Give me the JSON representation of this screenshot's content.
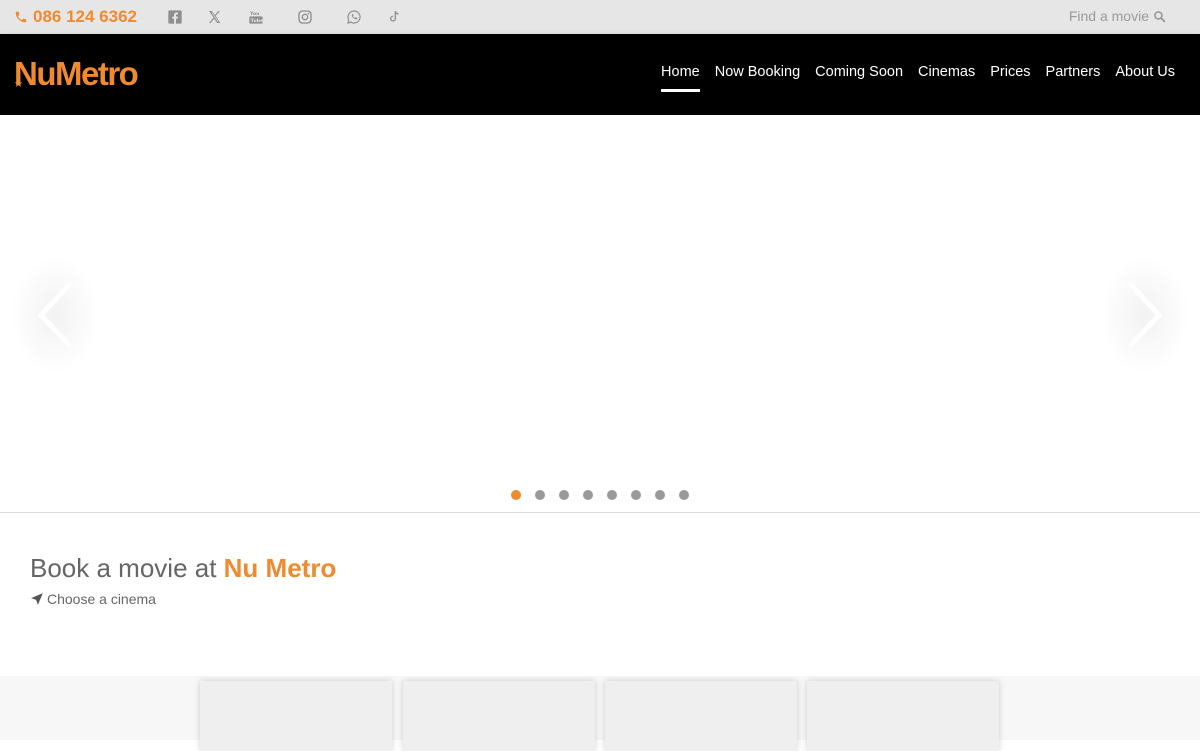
{
  "topbar": {
    "phone": "086 124 6362",
    "social_icons": [
      "facebook-icon",
      "x-icon",
      "youtube-icon",
      "instagram-icon",
      "whatsapp-icon",
      "tiktok-icon"
    ],
    "find_label": "Find a movie"
  },
  "brand": {
    "logo_text": "NuMetro",
    "accent_color": "#ef8a2e"
  },
  "nav": {
    "items": [
      {
        "label": "Home",
        "active": true
      },
      {
        "label": "Now Booking"
      },
      {
        "label": "Coming Soon"
      },
      {
        "label": "Cinemas"
      },
      {
        "label": "Prices"
      },
      {
        "label": "Partners"
      },
      {
        "label": "About Us"
      }
    ]
  },
  "carousel": {
    "active_index": 0,
    "slide_count": 8
  },
  "booking": {
    "title_prefix": "Book a movie at ",
    "title_brand": "Nu Metro",
    "choose_label": "Choose a cinema"
  },
  "cards": {
    "count": 4
  }
}
